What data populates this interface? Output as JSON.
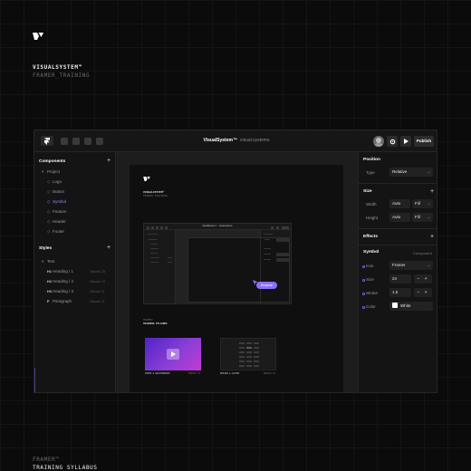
{
  "brand": {
    "title": "VISUALSYSTEM™",
    "subtitle": "FRAMER_TRAINING"
  },
  "footer": {
    "title": "FRAMER™",
    "subtitle": "TRAINING SYLLABUS"
  },
  "toolbar": {
    "title": "VisualSystem™",
    "subtitle": "visual.systems",
    "publish_label": "Publish",
    "icons": [
      "framer-menu-icon",
      "insert-icon",
      "layout-icon",
      "component-icon",
      "text-icon",
      "settings-icon",
      "preview-play-icon"
    ]
  },
  "left_panel": {
    "components": {
      "title": "Components",
      "project_label": "Project",
      "items": [
        {
          "label": "Logo"
        },
        {
          "label": "Button"
        },
        {
          "label": "Symbol"
        },
        {
          "label": "Feature"
        },
        {
          "label": "Header"
        },
        {
          "label": "Footer"
        }
      ]
    },
    "styles": {
      "title": "Styles",
      "text_label": "Text",
      "items": [
        {
          "badge": "H1",
          "label": "Heading / 1",
          "meta": "Satoshi 28"
        },
        {
          "badge": "H2",
          "label": "Heading / 2",
          "meta": "Satoshi 16"
        },
        {
          "badge": "H3",
          "label": "Heading / 3",
          "meta": "Satoshi 11"
        },
        {
          "badge": "P",
          "label": "Paragraph",
          "meta": "Satoshi 11"
        }
      ]
    }
  },
  "canvas": {
    "frame_title": "VISUALSYSTEM™",
    "frame_subtitle": "FRAMER_TRAINING",
    "mini_title": "VisualSystem™ · visual.systems",
    "cursor_label": "Benjamin",
    "section_label": "FRAMER™",
    "section_title": "TRAINING SYLLABUS",
    "cards": [
      {
        "title": "INTRO & WALKTHROUGH",
        "meta": "MODULE 01"
      },
      {
        "title": "DESIGN & LAYOUT",
        "meta": "MODULE 02"
      }
    ]
  },
  "right_panel": {
    "position": {
      "title": "Position",
      "type_label": "Type",
      "type_value": "Relative"
    },
    "size": {
      "title": "Size",
      "width_label": "Width",
      "width_value": "Auto",
      "width_mode": "Fill",
      "height_label": "Height",
      "height_value": "Auto",
      "height_mode": "Fill"
    },
    "effects": {
      "title": "Effects"
    },
    "symbol": {
      "title": "Symbol",
      "subtitle": "Component",
      "icon_label": "Icon",
      "icon_value": "Framer",
      "size_label": "Size",
      "size_value": "24",
      "stroke_label": "Stroke",
      "stroke_value": "1.5",
      "color_label": "Color",
      "color_value": "White",
      "stepper_text": "– +"
    }
  },
  "colors": {
    "accent": "#8b6ff5",
    "background": "#0b0b0c",
    "panel": "#141414"
  }
}
